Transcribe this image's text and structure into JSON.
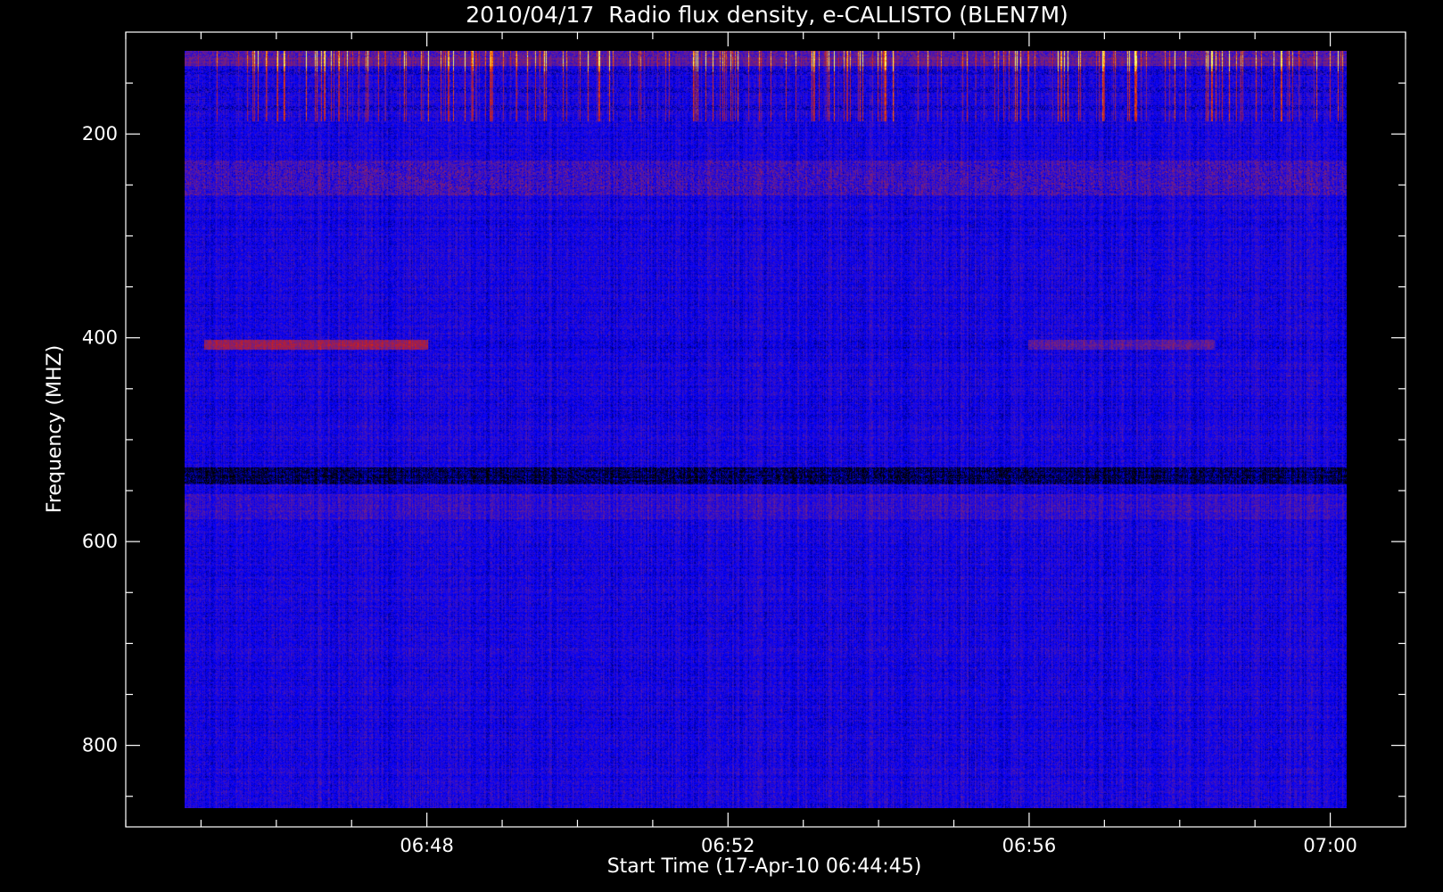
{
  "chart_data": {
    "type": "heatmap",
    "title": "2010/04/17  Radio flux density, e-CALLISTO (BLEN7M)",
    "xlabel": "Start Time (17-Apr-10 06:44:45)",
    "ylabel": "Frequency (MHZ)",
    "x_tick_labels": [
      "06:48",
      "06:52",
      "06:56",
      "07:00"
    ],
    "x_ticks_minutes": [
      48,
      52,
      56,
      60
    ],
    "x_minor_step_minutes": 1,
    "xlim_minutes": [
      44.0,
      61.0
    ],
    "data_x_range_minutes": [
      44.75,
      60.25
    ],
    "y_tick_labels": [
      "200",
      "400",
      "600",
      "800"
    ],
    "y_ticks": [
      200,
      400,
      600,
      800
    ],
    "y_minor_step": 50,
    "ylim": [
      880,
      100
    ],
    "data_y_range": [
      870,
      110
    ],
    "colormap": [
      "#000000",
      "#0000ff",
      "#6a1f8e",
      "#c81e1e",
      "#ff7a00",
      "#ffff66"
    ],
    "features": [
      {
        "band": [
          110,
          180
        ],
        "intensity": "high, bursty interference"
      },
      {
        "band": [
          220,
          255
        ],
        "intensity": "medium"
      },
      {
        "band": [
          400,
          410
        ],
        "intensity": "medium, 06:45-06:48"
      },
      {
        "band": [
          528,
          545
        ],
        "intensity": "low/dark"
      },
      {
        "band": [
          555,
          580
        ],
        "intensity": "medium"
      }
    ]
  }
}
